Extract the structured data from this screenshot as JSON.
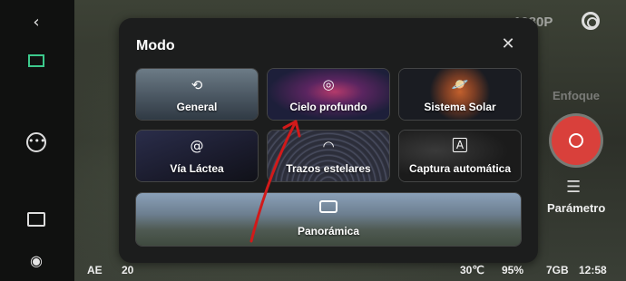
{
  "left_rail": {
    "back_icon": "chevron-left-icon",
    "gallery_icon": "gallery-icon",
    "more_icon": "more-icon",
    "image_icon": "image-icon",
    "eye_icon": "eye-icon"
  },
  "top_bar": {
    "resolution": "1080P"
  },
  "right_rail": {
    "focus_label": "Enfoque",
    "parameter_label": "Parámetro"
  },
  "modal": {
    "title": "Modo",
    "close_icon": "close-icon",
    "tiles": [
      {
        "label": "General",
        "icon": "camera-switch-icon"
      },
      {
        "label": "Cielo profundo",
        "icon": "target-icon"
      },
      {
        "label": "Sistema Solar",
        "icon": "planet-icon"
      },
      {
        "label": "Vía Láctea",
        "icon": "spiral-galaxy-icon"
      },
      {
        "label": "Trazos estelares",
        "icon": "star-trails-icon"
      },
      {
        "label": "Captura automática",
        "icon": "auto-capture-icon"
      },
      {
        "label": "Panorámica",
        "icon": "panorama-icon"
      }
    ]
  },
  "status_bar": {
    "ae": "AE",
    "exposure": "20",
    "temperature": "30℃",
    "battery": "95%",
    "storage": "7GB",
    "time": "12:58"
  },
  "annotation": {
    "color": "#d11a1a"
  }
}
